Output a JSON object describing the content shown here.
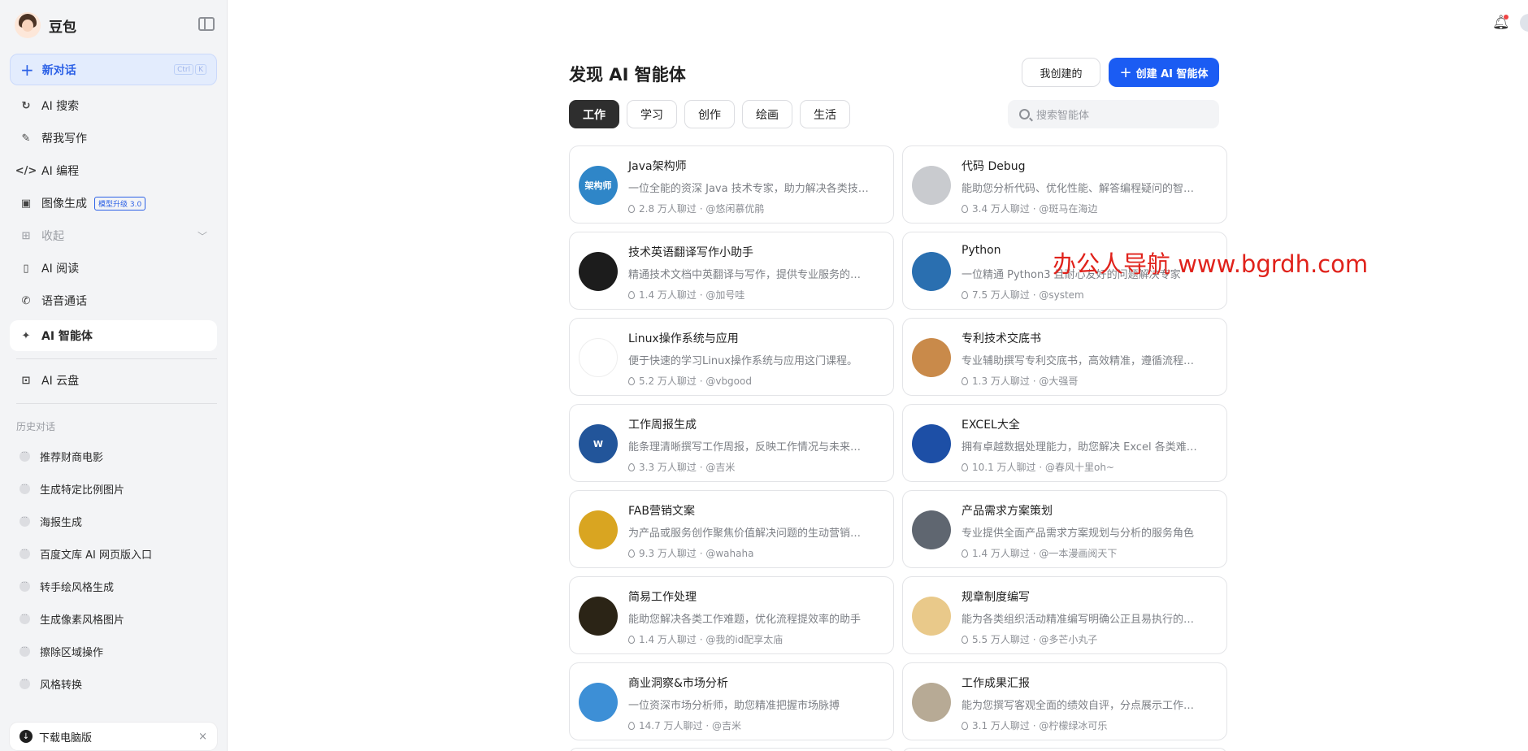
{
  "brand": {
    "name": "豆包"
  },
  "new_chat": {
    "label": "新对话",
    "kbd": [
      "Ctrl",
      "K"
    ]
  },
  "nav": [
    {
      "label": "AI 搜索",
      "icon": "refresh-search-icon"
    },
    {
      "label": "帮我写作",
      "icon": "pen-icon"
    },
    {
      "label": "AI 编程",
      "icon": "code-icon"
    },
    {
      "label": "图像生成",
      "icon": "image-icon",
      "badge": "模型升级 3.0"
    },
    {
      "label": "收起",
      "icon": "grid-icon"
    },
    {
      "label": "AI 阅读",
      "icon": "book-icon"
    },
    {
      "label": "语音通话",
      "icon": "phone-icon"
    },
    {
      "label": "AI 智能体",
      "icon": "sparkle-icon"
    },
    {
      "label": "AI 云盘",
      "icon": "cloud-folder-icon"
    }
  ],
  "history": {
    "title": "历史对话",
    "items": [
      "推荐财商电影",
      "生成特定比例图片",
      "海报生成",
      "百度文库 AI 网页版入口",
      "转手绘风格生成",
      "生成像素风格图片",
      "擦除区域操作",
      "风格转换"
    ]
  },
  "download": {
    "label": "下载电脑版",
    "close": "×"
  },
  "header": {
    "title": "发现 AI 智能体",
    "mine_label": "我创建的",
    "create_label": "创建 AI 智能体",
    "search_placeholder": "搜索智能体"
  },
  "tabs": [
    "工作",
    "学习",
    "创作",
    "绘画",
    "生活"
  ],
  "cards": [
    {
      "title": "Java架构师",
      "desc": "一位全能的资深 Java 技术专家，助力解决各类技…",
      "meta": "2.8 万人聊过 · @悠闲慕优鹃",
      "avatar_text": "架构师",
      "color": "#2f86c8"
    },
    {
      "title": "代码 Debug",
      "desc": "能助您分析代码、优化性能、解答编程疑问的智…",
      "meta": "3.4 万人聊过 · @斑马在海边",
      "avatar_text": "",
      "color": "#c9cbcf"
    },
    {
      "title": "技术英语翻译写作小助手",
      "desc": "精通技术文档中英翻译与写作，提供专业服务的…",
      "meta": "1.4 万人聊过 · @加号哇",
      "avatar_text": "",
      "color": "#1c1c1c"
    },
    {
      "title": "Python",
      "desc": "一位精通 Python3 且耐心友好的问题解决专家",
      "meta": "7.5 万人聊过 · @system",
      "avatar_text": "",
      "color": "#2a6fb0"
    },
    {
      "title": "Linux操作系统与应用",
      "desc": "便于快速的学习Linux操作系统与应用这门课程。",
      "meta": "5.2 万人聊过 · @vbgood",
      "avatar_text": "",
      "color": "#ffffff"
    },
    {
      "title": "专利技术交底书",
      "desc": "专业辅助撰写专利交底书，高效精准，遵循流程…",
      "meta": "1.3 万人聊过 · @大强哥",
      "avatar_text": "",
      "color": "#c98a4a"
    },
    {
      "title": "工作周报生成",
      "desc": "能条理清晰撰写工作周报，反映工作情况与未来…",
      "meta": "3.3 万人聊过 · @吉米",
      "avatar_text": "W",
      "color": "#22559a"
    },
    {
      "title": "EXCEL大全",
      "desc": "拥有卓越数据处理能力，助您解决 Excel 各类难…",
      "meta": "10.1 万人聊过 · @春风十里oh~",
      "avatar_text": "",
      "color": "#1d4fa6"
    },
    {
      "title": "FAB营销文案",
      "desc": "为产品或服务创作聚焦价值解决问题的生动营销…",
      "meta": "9.3 万人聊过 · @wahaha",
      "avatar_text": "",
      "color": "#d9a521"
    },
    {
      "title": "产品需求方案策划",
      "desc": "专业提供全面产品需求方案规划与分析的服务角色",
      "meta": "1.4 万人聊过 · @一本漫画阅天下",
      "avatar_text": "",
      "color": "#5f6670"
    },
    {
      "title": "简易工作处理",
      "desc": "能助您解决各类工作难题，优化流程提效率的助手",
      "meta": "1.4 万人聊过 · @我的id配享太庙",
      "avatar_text": "",
      "color": "#2b2416"
    },
    {
      "title": "规章制度编写",
      "desc": "能为各类组织活动精准编写明确公正且易执行的…",
      "meta": "5.5 万人聊过 · @多芒小丸子",
      "avatar_text": "",
      "color": "#e9c98a"
    },
    {
      "title": "商业洞察&市场分析",
      "desc": "一位资深市场分析师，助您精准把握市场脉搏",
      "meta": "14.7 万人聊过 · @吉米",
      "avatar_text": "",
      "color": "#3d8fd6"
    },
    {
      "title": "工作成果汇报",
      "desc": "能为您撰写客观全面的绩效自评，分点展示工作…",
      "meta": "3.1 万人聊过 · @柠檬绿冰可乐",
      "avatar_text": "",
      "color": "#b7aa95"
    }
  ],
  "watermark": "办公人导航 www.bgrdh.com"
}
